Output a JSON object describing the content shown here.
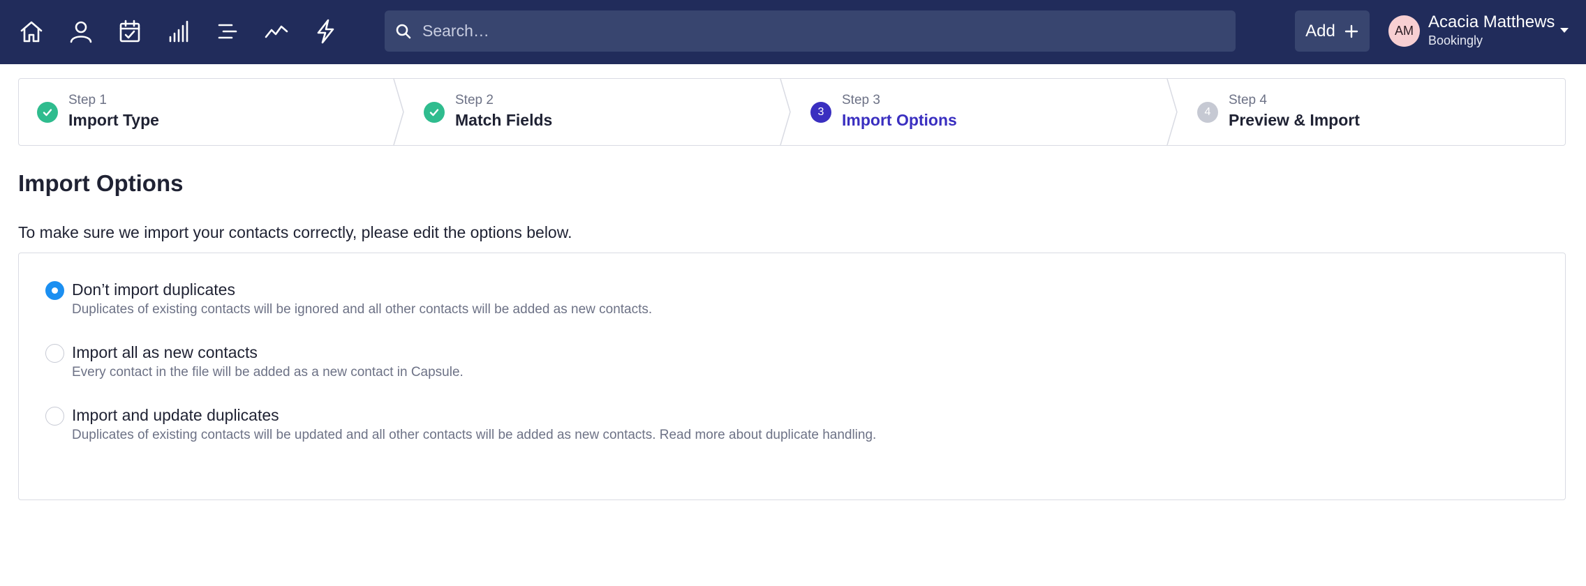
{
  "nav": {
    "icons": [
      "home-icon",
      "person-icon",
      "calendar-check-icon",
      "bar-chart-icon",
      "list-icon",
      "activity-icon",
      "lightning-icon"
    ]
  },
  "search": {
    "placeholder": "Search…",
    "icon": "search-icon"
  },
  "header": {
    "add_label": "Add",
    "user_initials": "AM",
    "user_name": "Acacia Matthews",
    "user_org": "Bookingly"
  },
  "stepper": {
    "steps": [
      {
        "kicker": "Step 1",
        "title": "Import Type",
        "state": "done",
        "number": "1"
      },
      {
        "kicker": "Step 2",
        "title": "Match Fields",
        "state": "done",
        "number": "2"
      },
      {
        "kicker": "Step 3",
        "title": "Import Options",
        "state": "active",
        "number": "3"
      },
      {
        "kicker": "Step 4",
        "title": "Preview & Import",
        "state": "todo",
        "number": "4"
      }
    ]
  },
  "main": {
    "title": "Import Options",
    "intro": "To make sure we import your contacts correctly, please edit the options below.",
    "options": [
      {
        "label": "Don’t import duplicates",
        "description": "Duplicates of existing contacts will be ignored and all other contacts will be added as new contacts.",
        "selected": true
      },
      {
        "label": "Import all as new contacts",
        "description": "Every contact in the file will be added as a new contact in Capsule.",
        "selected": false
      },
      {
        "label": "Import and update duplicates",
        "description": "Duplicates of existing contacts will be updated and all other contacts will be added as new contacts. Read more about duplicate handling.",
        "selected": false
      }
    ]
  },
  "colors": {
    "topbar": "#212c5b",
    "search_bg": "#38456f",
    "step_done": "#2fbc8e",
    "step_active": "#3a2fc0",
    "step_todo": "#c6c9d3",
    "radio_selected": "#1b8ff1"
  }
}
